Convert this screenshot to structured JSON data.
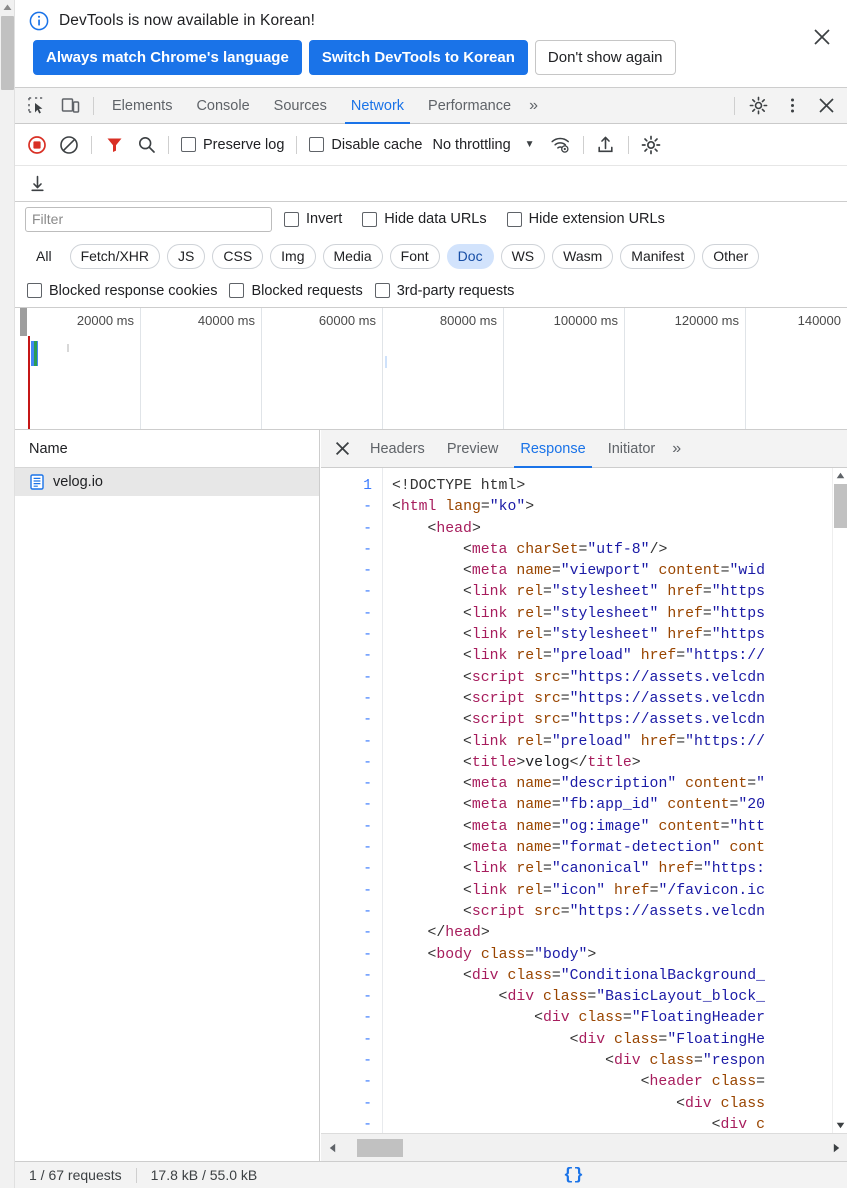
{
  "infobar": {
    "icon": "info-circle-icon",
    "message": "DevTools is now available in Korean!",
    "buttons": {
      "always_match": "Always match Chrome's language",
      "switch": "Switch DevTools to Korean",
      "dismiss": "Don't show again"
    },
    "close_icon": "close-icon"
  },
  "tabstrip": {
    "inspect_icon": "inspect-element-icon",
    "device_icon": "device-toolbar-icon",
    "tabs": [
      {
        "label": "Elements",
        "active": false
      },
      {
        "label": "Console",
        "active": false
      },
      {
        "label": "Sources",
        "active": false
      },
      {
        "label": "Network",
        "active": true
      },
      {
        "label": "Performance",
        "active": false
      }
    ],
    "more_tabs": "»",
    "settings_icon": "gear-icon",
    "kebab_icon": "more-vertical-icon",
    "close_icon": "close-icon"
  },
  "net_toolbar": {
    "record_icon": "record-stop-icon",
    "clear_icon": "clear-icon",
    "filter_icon": "filter-funnel-icon",
    "search_icon": "search-icon",
    "preserve_log": "Preserve log",
    "disable_cache": "Disable cache",
    "throttling": "No throttling",
    "throttle_arrow": "▼",
    "network_conditions_icon": "wifi-settings-icon",
    "import_icon": "import-har-icon",
    "settings_icon": "gear-icon",
    "export_icon": "export-har-icon"
  },
  "filterbar": {
    "placeholder": "Filter",
    "value": "",
    "invert": "Invert",
    "hide_data_urls": "Hide data URLs",
    "hide_extension_urls": "Hide extension URLs"
  },
  "type_chips": [
    {
      "label": "All",
      "active": false
    },
    {
      "label": "Fetch/XHR",
      "active": false
    },
    {
      "label": "JS",
      "active": false
    },
    {
      "label": "CSS",
      "active": false
    },
    {
      "label": "Img",
      "active": false
    },
    {
      "label": "Media",
      "active": false
    },
    {
      "label": "Font",
      "active": false
    },
    {
      "label": "Doc",
      "active": true
    },
    {
      "label": "WS",
      "active": false
    },
    {
      "label": "Wasm",
      "active": false
    },
    {
      "label": "Manifest",
      "active": false
    },
    {
      "label": "Other",
      "active": false
    }
  ],
  "blocked_row": {
    "blocked_response_cookies": "Blocked response cookies",
    "blocked_requests": "Blocked requests",
    "third_party_requests": "3rd-party requests"
  },
  "overview": {
    "ticks": [
      "20000 ms",
      "40000 ms",
      "60000 ms",
      "80000 ms",
      "100000 ms",
      "120000 ms",
      "140000"
    ]
  },
  "request_list": {
    "column_header": "Name",
    "rows": [
      {
        "name": "velog.io",
        "icon": "document-icon",
        "selected": true
      }
    ]
  },
  "detail": {
    "close_icon": "close-icon",
    "tabs": [
      {
        "label": "Headers",
        "active": false
      },
      {
        "label": "Preview",
        "active": false
      },
      {
        "label": "Response",
        "active": true
      },
      {
        "label": "Initiator",
        "active": false
      }
    ],
    "more_tabs": "»"
  },
  "code": {
    "line_numbers": [
      "1",
      "-",
      "-",
      "-",
      "-",
      "-",
      "-",
      "-",
      "-",
      "-",
      "-",
      "-",
      "-",
      "-",
      "-",
      "-",
      "-",
      "-",
      "-",
      "-",
      "-",
      "-",
      "-",
      "-",
      "-",
      "-",
      "-",
      "-",
      "-",
      "-",
      "-"
    ],
    "lines": [
      [
        {
          "t": "br",
          "s": "<!DOCTYPE html>"
        }
      ],
      [
        {
          "t": "br",
          "s": "<"
        },
        {
          "t": "pu",
          "s": "html"
        },
        {
          "t": "br",
          "s": " "
        },
        {
          "t": "at",
          "s": "lang"
        },
        {
          "t": "br",
          "s": "="
        },
        {
          "t": "va",
          "s": "\"ko\""
        },
        {
          "t": "br",
          "s": ">"
        }
      ],
      [
        {
          "t": "br",
          "s": "    <"
        },
        {
          "t": "pu",
          "s": "head"
        },
        {
          "t": "br",
          "s": ">"
        }
      ],
      [
        {
          "t": "br",
          "s": "        <"
        },
        {
          "t": "pu",
          "s": "meta"
        },
        {
          "t": "br",
          "s": " "
        },
        {
          "t": "at",
          "s": "charSet"
        },
        {
          "t": "br",
          "s": "="
        },
        {
          "t": "va",
          "s": "\"utf-8\""
        },
        {
          "t": "br",
          "s": "/>"
        }
      ],
      [
        {
          "t": "br",
          "s": "        <"
        },
        {
          "t": "pu",
          "s": "meta"
        },
        {
          "t": "br",
          "s": " "
        },
        {
          "t": "at",
          "s": "name"
        },
        {
          "t": "br",
          "s": "="
        },
        {
          "t": "va",
          "s": "\"viewport\""
        },
        {
          "t": "br",
          "s": " "
        },
        {
          "t": "at",
          "s": "content"
        },
        {
          "t": "br",
          "s": "="
        },
        {
          "t": "va",
          "s": "\"wid"
        }
      ],
      [
        {
          "t": "br",
          "s": "        <"
        },
        {
          "t": "pu",
          "s": "link"
        },
        {
          "t": "br",
          "s": " "
        },
        {
          "t": "at",
          "s": "rel"
        },
        {
          "t": "br",
          "s": "="
        },
        {
          "t": "va",
          "s": "\"stylesheet\""
        },
        {
          "t": "br",
          "s": " "
        },
        {
          "t": "at",
          "s": "href"
        },
        {
          "t": "br",
          "s": "="
        },
        {
          "t": "va",
          "s": "\"https"
        }
      ],
      [
        {
          "t": "br",
          "s": "        <"
        },
        {
          "t": "pu",
          "s": "link"
        },
        {
          "t": "br",
          "s": " "
        },
        {
          "t": "at",
          "s": "rel"
        },
        {
          "t": "br",
          "s": "="
        },
        {
          "t": "va",
          "s": "\"stylesheet\""
        },
        {
          "t": "br",
          "s": " "
        },
        {
          "t": "at",
          "s": "href"
        },
        {
          "t": "br",
          "s": "="
        },
        {
          "t": "va",
          "s": "\"https"
        }
      ],
      [
        {
          "t": "br",
          "s": "        <"
        },
        {
          "t": "pu",
          "s": "link"
        },
        {
          "t": "br",
          "s": " "
        },
        {
          "t": "at",
          "s": "rel"
        },
        {
          "t": "br",
          "s": "="
        },
        {
          "t": "va",
          "s": "\"stylesheet\""
        },
        {
          "t": "br",
          "s": " "
        },
        {
          "t": "at",
          "s": "href"
        },
        {
          "t": "br",
          "s": "="
        },
        {
          "t": "va",
          "s": "\"https"
        }
      ],
      [
        {
          "t": "br",
          "s": "        <"
        },
        {
          "t": "pu",
          "s": "link"
        },
        {
          "t": "br",
          "s": " "
        },
        {
          "t": "at",
          "s": "rel"
        },
        {
          "t": "br",
          "s": "="
        },
        {
          "t": "va",
          "s": "\"preload\""
        },
        {
          "t": "br",
          "s": " "
        },
        {
          "t": "at",
          "s": "href"
        },
        {
          "t": "br",
          "s": "="
        },
        {
          "t": "va",
          "s": "\"https://"
        }
      ],
      [
        {
          "t": "br",
          "s": "        <"
        },
        {
          "t": "pu",
          "s": "script"
        },
        {
          "t": "br",
          "s": " "
        },
        {
          "t": "at",
          "s": "src"
        },
        {
          "t": "br",
          "s": "="
        },
        {
          "t": "va",
          "s": "\"https://assets.velcdn"
        }
      ],
      [
        {
          "t": "br",
          "s": "        <"
        },
        {
          "t": "pu",
          "s": "script"
        },
        {
          "t": "br",
          "s": " "
        },
        {
          "t": "at",
          "s": "src"
        },
        {
          "t": "br",
          "s": "="
        },
        {
          "t": "va",
          "s": "\"https://assets.velcdn"
        }
      ],
      [
        {
          "t": "br",
          "s": "        <"
        },
        {
          "t": "pu",
          "s": "script"
        },
        {
          "t": "br",
          "s": " "
        },
        {
          "t": "at",
          "s": "src"
        },
        {
          "t": "br",
          "s": "="
        },
        {
          "t": "va",
          "s": "\"https://assets.velcdn"
        }
      ],
      [
        {
          "t": "br",
          "s": "        <"
        },
        {
          "t": "pu",
          "s": "link"
        },
        {
          "t": "br",
          "s": " "
        },
        {
          "t": "at",
          "s": "rel"
        },
        {
          "t": "br",
          "s": "="
        },
        {
          "t": "va",
          "s": "\"preload\""
        },
        {
          "t": "br",
          "s": " "
        },
        {
          "t": "at",
          "s": "href"
        },
        {
          "t": "br",
          "s": "="
        },
        {
          "t": "va",
          "s": "\"https://"
        }
      ],
      [
        {
          "t": "br",
          "s": "        <"
        },
        {
          "t": "pu",
          "s": "title"
        },
        {
          "t": "br",
          "s": ">"
        },
        {
          "t": "tx",
          "s": "velog"
        },
        {
          "t": "br",
          "s": "</"
        },
        {
          "t": "pu",
          "s": "title"
        },
        {
          "t": "br",
          "s": ">"
        }
      ],
      [
        {
          "t": "br",
          "s": "        <"
        },
        {
          "t": "pu",
          "s": "meta"
        },
        {
          "t": "br",
          "s": " "
        },
        {
          "t": "at",
          "s": "name"
        },
        {
          "t": "br",
          "s": "="
        },
        {
          "t": "va",
          "s": "\"description\""
        },
        {
          "t": "br",
          "s": " "
        },
        {
          "t": "at",
          "s": "content"
        },
        {
          "t": "br",
          "s": "="
        },
        {
          "t": "va",
          "s": "\""
        }
      ],
      [
        {
          "t": "br",
          "s": "        <"
        },
        {
          "t": "pu",
          "s": "meta"
        },
        {
          "t": "br",
          "s": " "
        },
        {
          "t": "at",
          "s": "name"
        },
        {
          "t": "br",
          "s": "="
        },
        {
          "t": "va",
          "s": "\"fb:app_id\""
        },
        {
          "t": "br",
          "s": " "
        },
        {
          "t": "at",
          "s": "content"
        },
        {
          "t": "br",
          "s": "="
        },
        {
          "t": "va",
          "s": "\"20"
        }
      ],
      [
        {
          "t": "br",
          "s": "        <"
        },
        {
          "t": "pu",
          "s": "meta"
        },
        {
          "t": "br",
          "s": " "
        },
        {
          "t": "at",
          "s": "name"
        },
        {
          "t": "br",
          "s": "="
        },
        {
          "t": "va",
          "s": "\"og:image\""
        },
        {
          "t": "br",
          "s": " "
        },
        {
          "t": "at",
          "s": "content"
        },
        {
          "t": "br",
          "s": "="
        },
        {
          "t": "va",
          "s": "\"htt"
        }
      ],
      [
        {
          "t": "br",
          "s": "        <"
        },
        {
          "t": "pu",
          "s": "meta"
        },
        {
          "t": "br",
          "s": " "
        },
        {
          "t": "at",
          "s": "name"
        },
        {
          "t": "br",
          "s": "="
        },
        {
          "t": "va",
          "s": "\"format-detection\""
        },
        {
          "t": "br",
          "s": " "
        },
        {
          "t": "at",
          "s": "cont"
        }
      ],
      [
        {
          "t": "br",
          "s": "        <"
        },
        {
          "t": "pu",
          "s": "link"
        },
        {
          "t": "br",
          "s": " "
        },
        {
          "t": "at",
          "s": "rel"
        },
        {
          "t": "br",
          "s": "="
        },
        {
          "t": "va",
          "s": "\"canonical\""
        },
        {
          "t": "br",
          "s": " "
        },
        {
          "t": "at",
          "s": "href"
        },
        {
          "t": "br",
          "s": "="
        },
        {
          "t": "va",
          "s": "\"https:"
        }
      ],
      [
        {
          "t": "br",
          "s": "        <"
        },
        {
          "t": "pu",
          "s": "link"
        },
        {
          "t": "br",
          "s": " "
        },
        {
          "t": "at",
          "s": "rel"
        },
        {
          "t": "br",
          "s": "="
        },
        {
          "t": "va",
          "s": "\"icon\""
        },
        {
          "t": "br",
          "s": " "
        },
        {
          "t": "at",
          "s": "href"
        },
        {
          "t": "br",
          "s": "="
        },
        {
          "t": "va",
          "s": "\"/favicon.ic"
        }
      ],
      [
        {
          "t": "br",
          "s": "        <"
        },
        {
          "t": "pu",
          "s": "script"
        },
        {
          "t": "br",
          "s": " "
        },
        {
          "t": "at",
          "s": "src"
        },
        {
          "t": "br",
          "s": "="
        },
        {
          "t": "va",
          "s": "\"https://assets.velcdn"
        }
      ],
      [
        {
          "t": "br",
          "s": "    </"
        },
        {
          "t": "pu",
          "s": "head"
        },
        {
          "t": "br",
          "s": ">"
        }
      ],
      [
        {
          "t": "br",
          "s": "    <"
        },
        {
          "t": "pu",
          "s": "body"
        },
        {
          "t": "br",
          "s": " "
        },
        {
          "t": "at",
          "s": "class"
        },
        {
          "t": "br",
          "s": "="
        },
        {
          "t": "va",
          "s": "\"body\""
        },
        {
          "t": "br",
          "s": ">"
        }
      ],
      [
        {
          "t": "br",
          "s": "        <"
        },
        {
          "t": "pu",
          "s": "div"
        },
        {
          "t": "br",
          "s": " "
        },
        {
          "t": "at",
          "s": "class"
        },
        {
          "t": "br",
          "s": "="
        },
        {
          "t": "va",
          "s": "\"ConditionalBackground_"
        }
      ],
      [
        {
          "t": "br",
          "s": "            <"
        },
        {
          "t": "pu",
          "s": "div"
        },
        {
          "t": "br",
          "s": " "
        },
        {
          "t": "at",
          "s": "class"
        },
        {
          "t": "br",
          "s": "="
        },
        {
          "t": "va",
          "s": "\"BasicLayout_block_"
        }
      ],
      [
        {
          "t": "br",
          "s": "                <"
        },
        {
          "t": "pu",
          "s": "div"
        },
        {
          "t": "br",
          "s": " "
        },
        {
          "t": "at",
          "s": "class"
        },
        {
          "t": "br",
          "s": "="
        },
        {
          "t": "va",
          "s": "\"FloatingHeader"
        }
      ],
      [
        {
          "t": "br",
          "s": "                    <"
        },
        {
          "t": "pu",
          "s": "div"
        },
        {
          "t": "br",
          "s": " "
        },
        {
          "t": "at",
          "s": "class"
        },
        {
          "t": "br",
          "s": "="
        },
        {
          "t": "va",
          "s": "\"FloatingHe"
        }
      ],
      [
        {
          "t": "br",
          "s": "                        <"
        },
        {
          "t": "pu",
          "s": "div"
        },
        {
          "t": "br",
          "s": " "
        },
        {
          "t": "at",
          "s": "class"
        },
        {
          "t": "br",
          "s": "="
        },
        {
          "t": "va",
          "s": "\"respon"
        }
      ],
      [
        {
          "t": "br",
          "s": "                            <"
        },
        {
          "t": "pu",
          "s": "header"
        },
        {
          "t": "br",
          "s": " "
        },
        {
          "t": "at",
          "s": "class"
        },
        {
          "t": "br",
          "s": "="
        }
      ],
      [
        {
          "t": "br",
          "s": "                                <"
        },
        {
          "t": "pu",
          "s": "div"
        },
        {
          "t": "br",
          "s": " "
        },
        {
          "t": "at",
          "s": "class"
        }
      ],
      [
        {
          "t": "br",
          "s": "                                    <"
        },
        {
          "t": "pu",
          "s": "div"
        },
        {
          "t": "br",
          "s": " "
        },
        {
          "t": "at",
          "s": "c"
        }
      ]
    ]
  },
  "statusbar": {
    "requests": "1 / 67 requests",
    "transferred": "17.8 kB / 55.0 kB",
    "pretty_print": "{}"
  },
  "colors": {
    "accent_blue": "#1a73e8",
    "chip_active_bg": "#d2e3fc",
    "record_red": "#d93025",
    "filter_red": "#d93025",
    "selected_row_bg": "#e7e7e7",
    "tag": "#a71d5d",
    "attr_name": "#994500",
    "attr_value": "#1a1aa6"
  }
}
